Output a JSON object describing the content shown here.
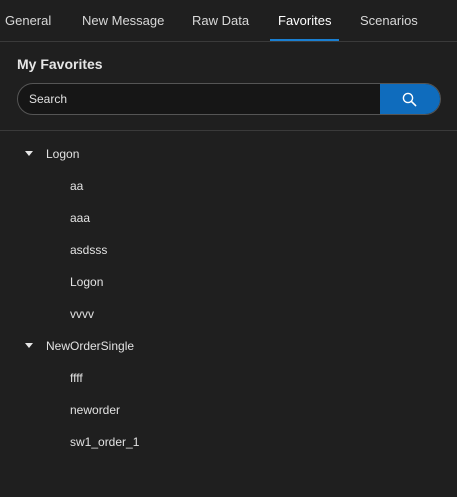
{
  "tabs": [
    {
      "label": "General"
    },
    {
      "label": "New Message"
    },
    {
      "label": "Raw Data"
    },
    {
      "label": "Favorites",
      "active": true
    },
    {
      "label": "Scenarios"
    }
  ],
  "favorites": {
    "title": "My Favorites",
    "search": {
      "placeholder": "Search",
      "value": "",
      "button_icon": "search-icon"
    },
    "groups": [
      {
        "label": "Logon",
        "expanded": true,
        "items": [
          "aa",
          "aaa",
          "asdsss",
          "Logon",
          "vvvv"
        ]
      },
      {
        "label": "NewOrderSingle",
        "expanded": true,
        "items": [
          "ffff",
          "neworder",
          "sw1_order_1"
        ]
      }
    ]
  },
  "colors": {
    "background": "#1f1f1f",
    "accent": "#1a7fd1",
    "search_button": "#0f6cbd"
  }
}
